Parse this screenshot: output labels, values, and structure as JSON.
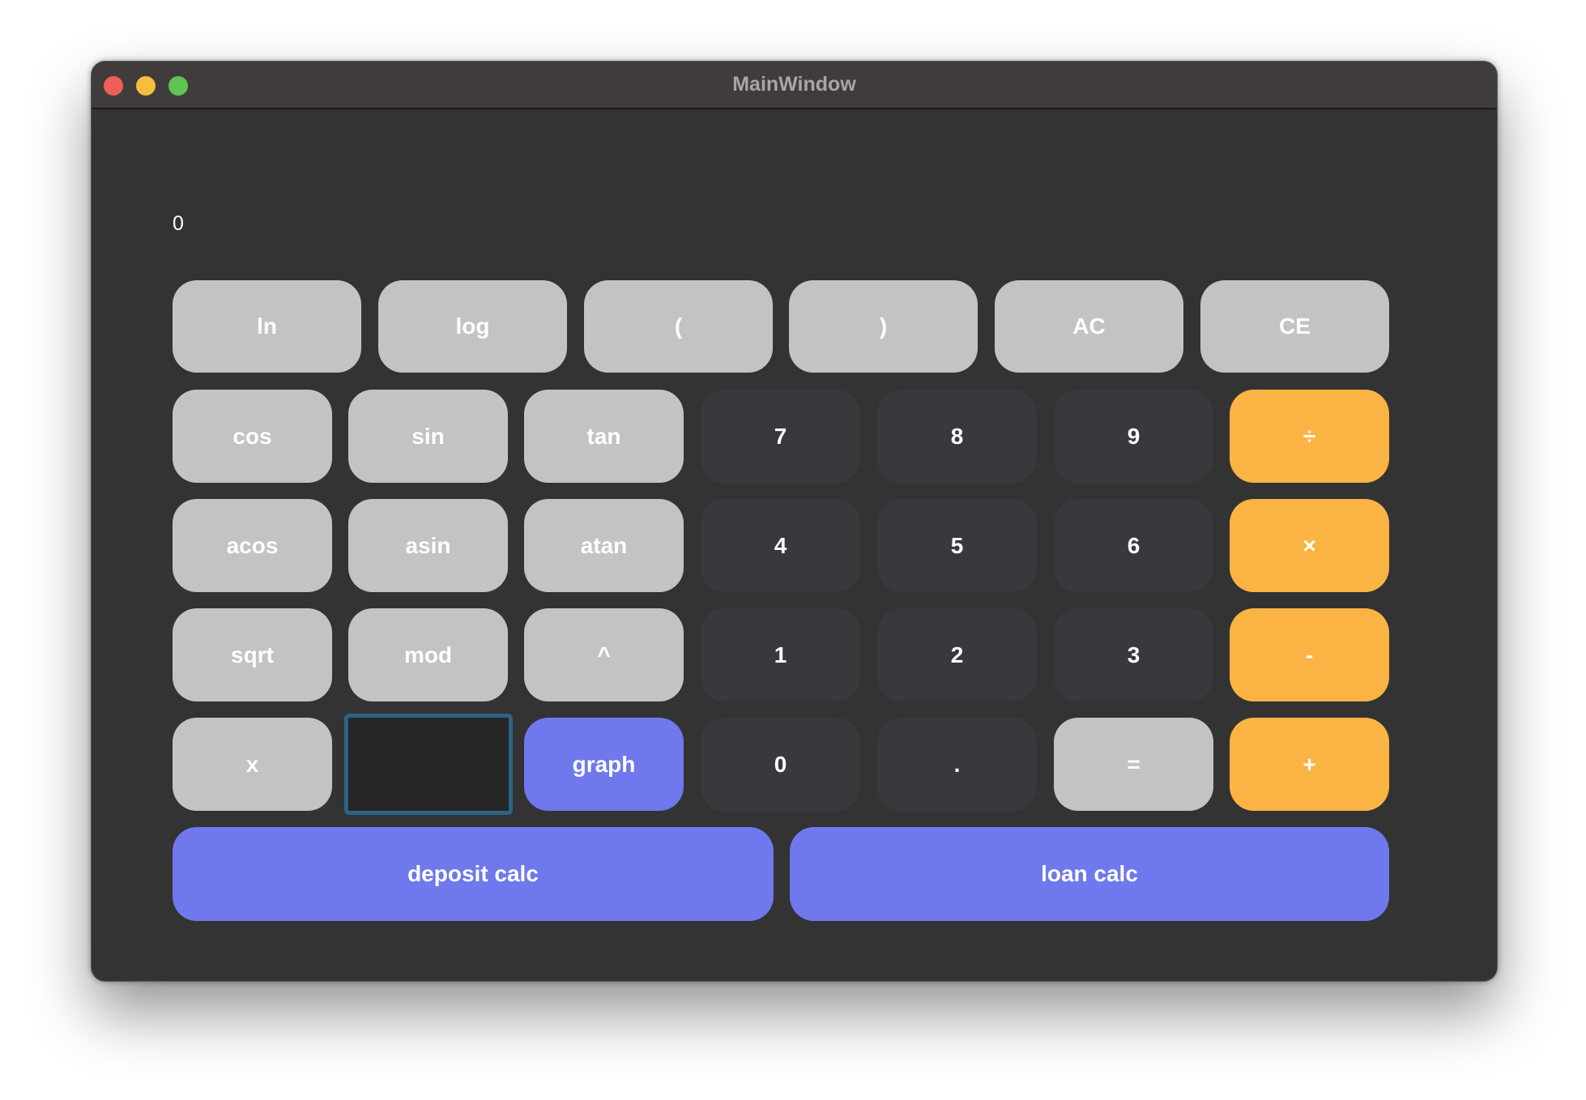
{
  "window": {
    "title": "MainWindow",
    "traffic_lights": {
      "close_color": "#ee5f57",
      "minimize_color": "#f6bd3f",
      "maximize_color": "#5fc454"
    }
  },
  "display": {
    "value": "0"
  },
  "colors": {
    "window_bg": "#333333",
    "function_button": "#c3c3c3",
    "digit_button": "#38393d",
    "operator_button": "#fbb443",
    "accent_button": "#6f78ec",
    "input_border": "#2b6384"
  },
  "buttons": {
    "row1": [
      "ln",
      "log",
      "(",
      ")",
      "AC",
      "CE"
    ],
    "row2": [
      "cos",
      "sin",
      "tan",
      "7",
      "8",
      "9",
      "÷"
    ],
    "row3": [
      "acos",
      "asin",
      "atan",
      "4",
      "5",
      "6",
      "×"
    ],
    "row4": [
      "sqrt",
      "mod",
      "^",
      "1",
      "2",
      "3",
      "-"
    ],
    "row5": [
      "x",
      "",
      "graph",
      "0",
      ".",
      "=",
      "+"
    ],
    "row6": [
      "deposit calc",
      "loan calc"
    ]
  },
  "x_input": {
    "value": ""
  }
}
